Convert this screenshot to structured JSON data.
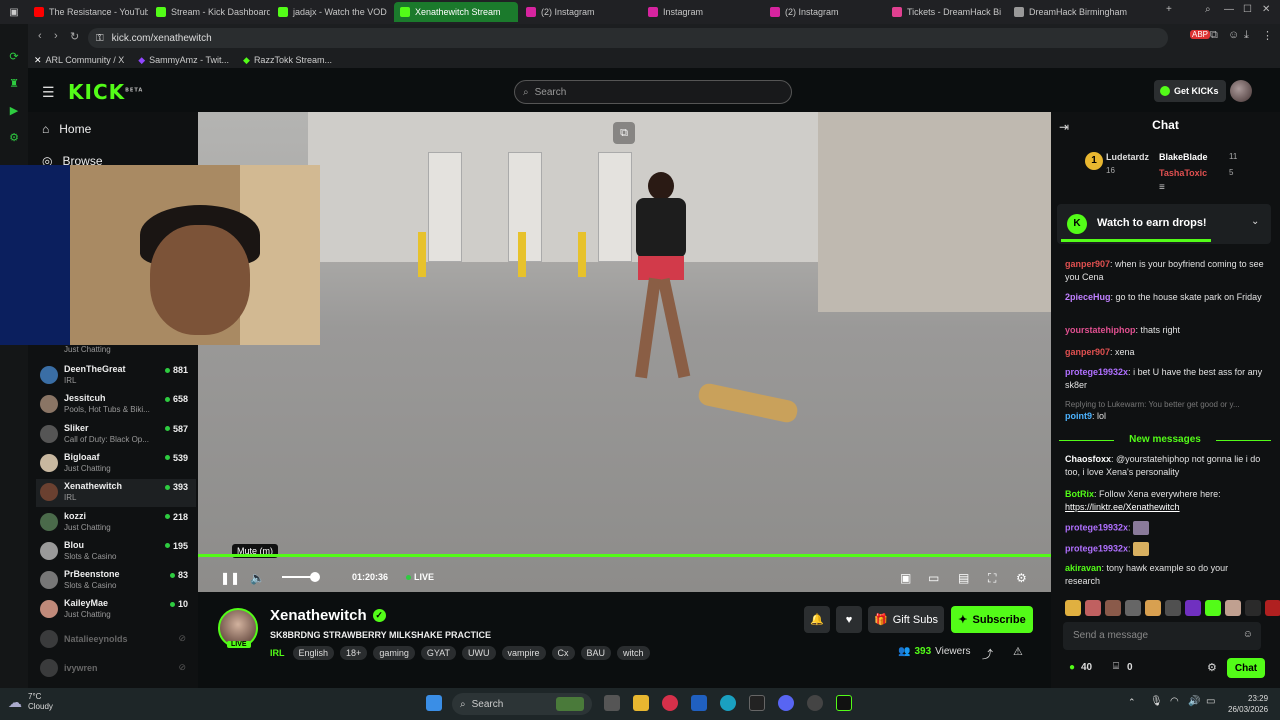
{
  "browser": {
    "tabs": [
      {
        "label": "The Resistance - YouTube",
        "color": "#ff0000",
        "active": false
      },
      {
        "label": "Stream - Kick Dashboard",
        "color": "#53fc18",
        "active": false
      },
      {
        "label": "jadajx - Watch the VOD",
        "color": "#53fc18",
        "active": false
      },
      {
        "label": "Xenathewitch Stream",
        "color": "#53fc18",
        "active": true
      },
      {
        "label": "(2) Instagram",
        "color": "#d6249f",
        "active": false
      },
      {
        "label": "Instagram",
        "color": "#d6249f",
        "active": false
      },
      {
        "label": "(2) Instagram",
        "color": "#d6249f",
        "active": false
      },
      {
        "label": "Tickets - DreamHack Bi",
        "color": "#e04090",
        "active": false
      },
      {
        "label": "DreamHack Birmingham",
        "color": "#999999",
        "active": false
      }
    ],
    "url": "kick.com/xenathewitch",
    "bookmarks": [
      {
        "label": "ARL Community / X",
        "icon": "x-icon"
      },
      {
        "label": "SammyAmz - Twit...",
        "icon": "twitch-icon"
      },
      {
        "label": "RazzTokk Stream...",
        "icon": "kick-icon"
      }
    ]
  },
  "header": {
    "logo": "KICK",
    "logo_badge": "BETA",
    "search_placeholder": "Search",
    "get_kicks": "Get KICKs"
  },
  "sidebar": {
    "nav": [
      {
        "label": "Home",
        "icon": "home-icon"
      },
      {
        "label": "Browse",
        "icon": "browse-icon"
      }
    ],
    "partial_category": "Just Chatting",
    "channels": [
      {
        "name": "DeenTheGreat",
        "category": "IRL",
        "viewers": "881",
        "color": "#3a6ea5"
      },
      {
        "name": "Jessitcuh",
        "category": "Pools, Hot Tubs & Biki...",
        "viewers": "658",
        "color": "#8a7565"
      },
      {
        "name": "Sliker",
        "category": "Call of Duty: Black Op...",
        "viewers": "587",
        "color": "#555555"
      },
      {
        "name": "Bigloaaf",
        "category": "Just Chatting",
        "viewers": "539",
        "color": "#c8b8a0"
      },
      {
        "name": "Xenathewitch",
        "category": "IRL",
        "viewers": "393",
        "color": "#6a4030",
        "active": true
      },
      {
        "name": "kozzi",
        "category": "Just Chatting",
        "viewers": "218",
        "color": "#4a6a4a"
      },
      {
        "name": "Blou",
        "category": "Slots & Casino",
        "viewers": "195",
        "color": "#9a9a9a"
      },
      {
        "name": "PrBeenstone",
        "category": "Slots & Casino",
        "viewers": "83",
        "color": "#777777"
      },
      {
        "name": "KaileyMae",
        "category": "Just Chatting",
        "viewers": "10",
        "color": "#c08a7a"
      },
      {
        "name": "Natalieeynolds",
        "category": "",
        "viewers": "",
        "color": "#666666",
        "offline": true
      },
      {
        "name": "ivywren",
        "category": "",
        "viewers": "",
        "color": "#666666",
        "offline": true
      }
    ]
  },
  "player": {
    "tooltip": "Mute (m)",
    "time": "01:20:36",
    "live": "LIVE",
    "volume_level": 0.8,
    "progress": 1.0
  },
  "stream": {
    "name": "Xenathewitch",
    "title": "SK8BRDNG STRAWBERRY MILKSHAKE PRACTICE",
    "live_badge": "LIVE",
    "category": "IRL",
    "tags": [
      "English",
      "18+",
      "gaming",
      "GYAT",
      "UWU",
      "vampire",
      "Cx",
      "BAU",
      "witch"
    ],
    "gift_subs": "Gift Subs",
    "subscribe": "Subscribe",
    "viewers": "393",
    "viewers_label": "Viewers"
  },
  "chat": {
    "title": "Chat",
    "leaderboard": [
      {
        "name": "Ludetardz",
        "count": "16",
        "rank": "1"
      },
      {
        "name": "BlakeBlade",
        "count": "11"
      },
      {
        "name": "TashaToxic",
        "count": "5"
      }
    ],
    "drops_label": "Watch to earn drops!",
    "messages_before": [
      {
        "user": "ganper907",
        "color": "#e05050",
        "text": "when is your boyfriend coming to see you Cena"
      },
      {
        "user": "2pieceHug",
        "color": "#c080ff",
        "text": "go to the house skate park on Friday"
      },
      {
        "user": "yourstatehiphop",
        "color": "#e05090",
        "text": "thats right"
      },
      {
        "user": "ganper907",
        "color": "#e05050",
        "text": "xena"
      },
      {
        "user": "protege19932x",
        "color": "#b070ff",
        "text": "i bet U have the best ass for any sk8er"
      }
    ],
    "reply_context": "Replying to Lukewarm: You better get good or y...",
    "reply_user": "point9",
    "reply_text": "lol",
    "new_messages": "New messages",
    "messages_after": [
      {
        "user": "Chaosfoxx",
        "color": "#ffffff",
        "text": "@yourstatehiphop not gonna lie i do too, i love Xena's personality"
      },
      {
        "user": "BotRix",
        "color": "#53fc18",
        "text": "Follow Xena everywhere here:"
      },
      {
        "user": "protege19932x",
        "color": "#b070ff",
        "text": ""
      },
      {
        "user": "protege19932x",
        "color": "#b070ff",
        "text": ""
      },
      {
        "user": "akiravan",
        "color": "#53fc18",
        "text": "tony hawk example so do your research"
      }
    ],
    "botrix_link": "https://linktr.ee/Xenathewitch",
    "input_placeholder": "Send a message",
    "points": "40",
    "gifts": "0",
    "chat_button": "Chat"
  },
  "taskbar": {
    "temp": "7°C",
    "weather": "Cloudy",
    "search": "Search",
    "time": "23:29",
    "date": "26/03/2026"
  }
}
